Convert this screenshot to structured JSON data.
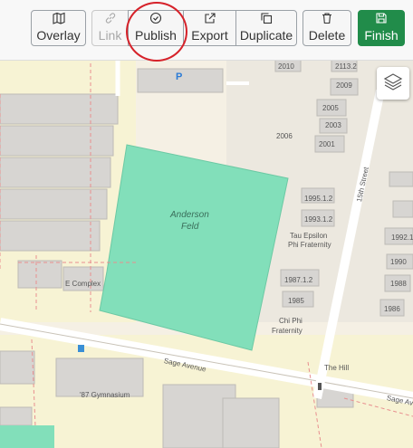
{
  "toolbar": {
    "overlay": "Overlay",
    "link": "Link",
    "publish": "Publish",
    "export": "Export",
    "duplicate": "Duplicate",
    "delete": "Delete",
    "finish": "Finish"
  },
  "map": {
    "field_line1": "Anderson",
    "field_line2": "Feld",
    "complex": "E Complex",
    "street_sage": "Sage Avenue",
    "street_sage2": "Sage Ave",
    "street_15th": "15th Street",
    "tau1": "Tau Epsilon",
    "tau2": "Phi Fraternity",
    "chi1": "Chi Phi",
    "chi2": "Fraternity",
    "gym": "'87 Gymnasium",
    "hill": "The Hill",
    "p": "P",
    "buildings": [
      "2010",
      "2113.2",
      "2009",
      "2005",
      "2003",
      "2001",
      "2006",
      "1995.1.2",
      "1993.1.2",
      "1987.1.2",
      "1985",
      "1992.1",
      "1990",
      "1988",
      "1986"
    ]
  }
}
